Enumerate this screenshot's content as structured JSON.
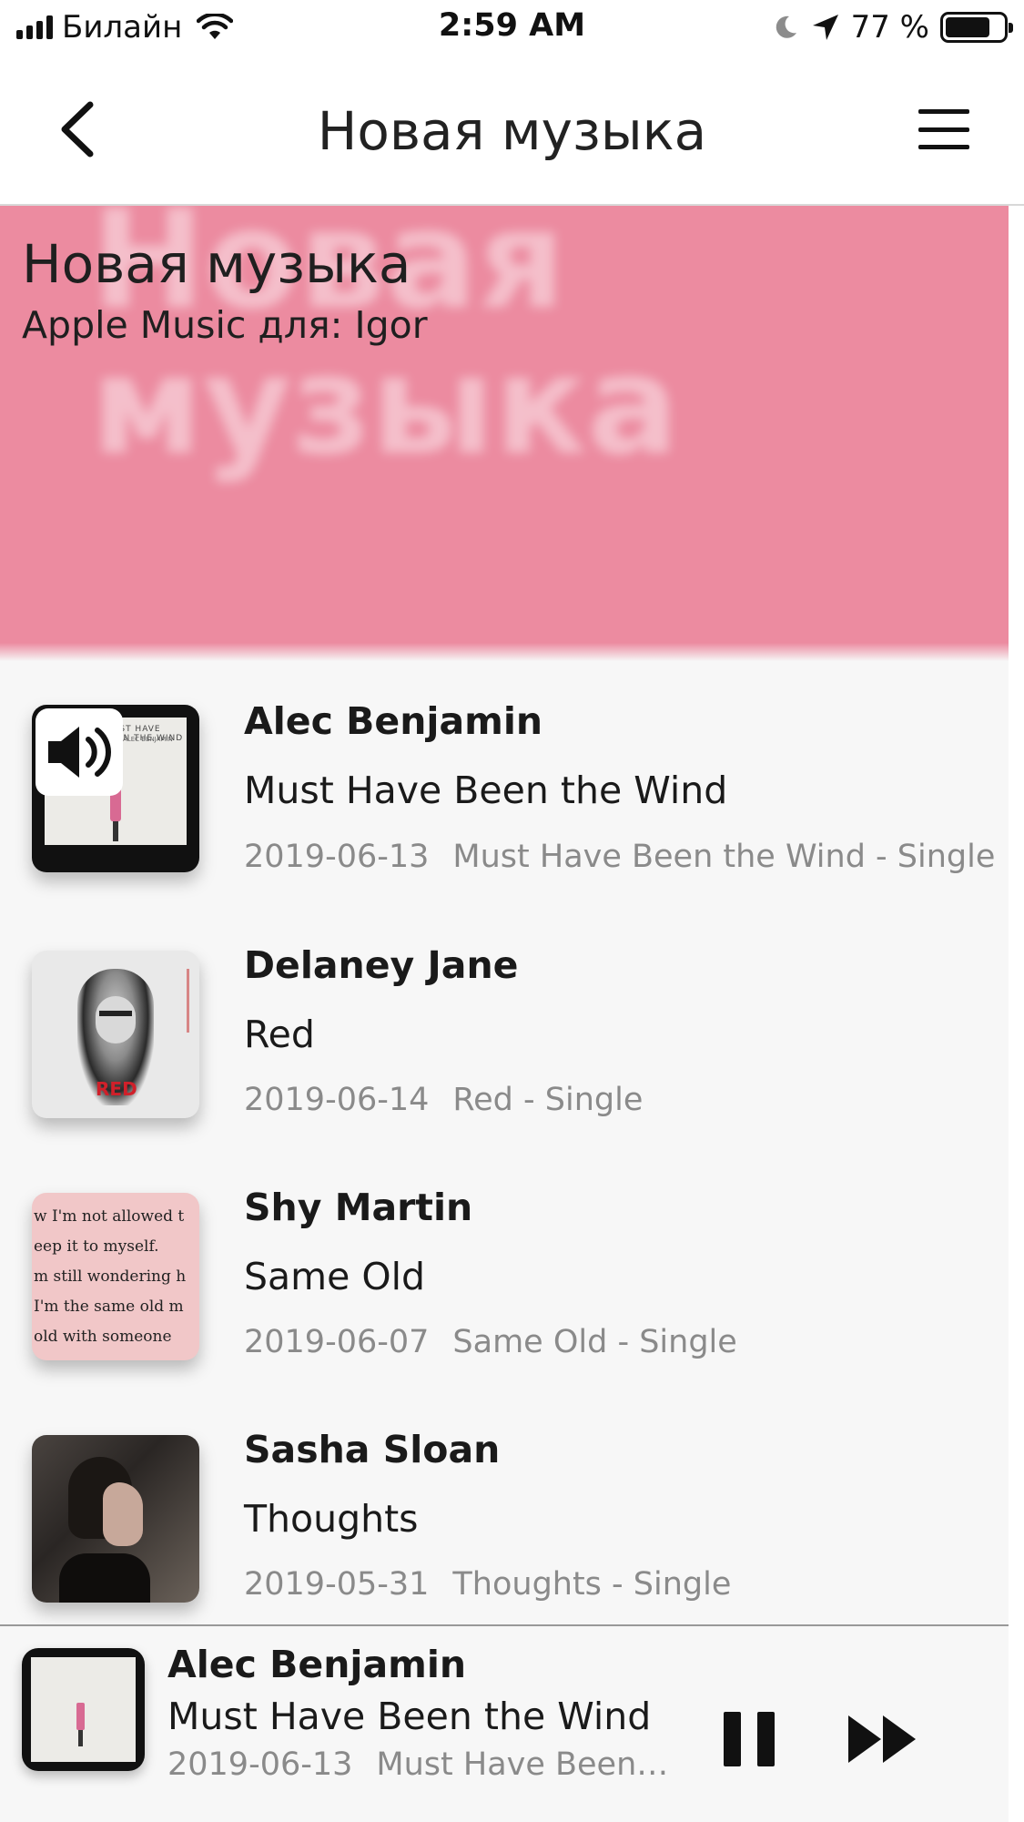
{
  "status_bar": {
    "carrier": "Билайн",
    "time": "2:59 AM",
    "battery": "77 %"
  },
  "nav": {
    "title": "Новая музыка",
    "back_icon": "chevron-left-icon",
    "menu_icon": "hamburger-icon"
  },
  "hero": {
    "title": "Новая музыка",
    "subtitle": "Apple Music для: Igor",
    "background_text": "Новая музыка",
    "color": "#ec8ba0"
  },
  "tracks": [
    {
      "artist": "Alec Benjamin",
      "title": "Must Have Been the Wind",
      "date": "2019-06-13",
      "album": "Must Have Been the Wind - Single",
      "playing": true
    },
    {
      "artist": "Delaney Jane",
      "title": "Red",
      "date": "2019-06-14",
      "album": "Red - Single",
      "playing": false
    },
    {
      "artist": "Shy Martin",
      "title": "Same Old",
      "date": "2019-06-07",
      "album": "Same Old - Single",
      "playing": false
    },
    {
      "artist": "Sasha Sloan",
      "title": "Thoughts",
      "date": "2019-05-31",
      "album": "Thoughts - Single",
      "playing": false
    }
  ],
  "artwork_text": {
    "alec": "MUST HAVE BEEN THE WIND",
    "alec_sub": "ALEC BENJAMIN",
    "delaney": "RED",
    "shy_martin": [
      "w I'm not allowed t",
      "eep it to myself.",
      "m still wondering h",
      "I'm the same old m",
      "old with someone"
    ]
  },
  "player": {
    "artist": "Alec Benjamin",
    "title": "Must Have Been the Wind",
    "date": "2019-06-13",
    "album": "Must Have Been th...",
    "pause_icon": "pause-icon",
    "next_icon": "fast-forward-icon"
  }
}
